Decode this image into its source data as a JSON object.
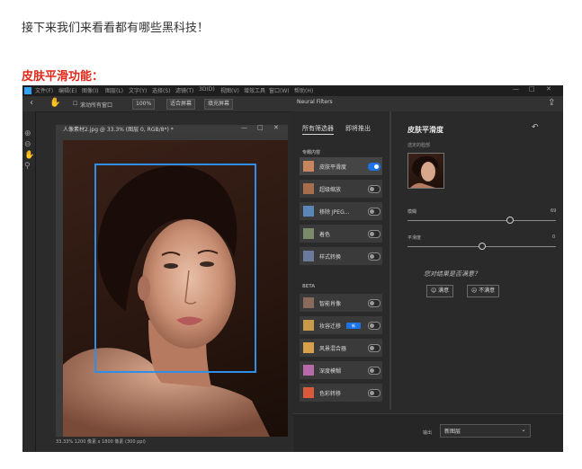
{
  "article": {
    "intro": "接下来我们来看看都有哪些黑科技！",
    "section_title": "皮肤平滑功能："
  },
  "app": {
    "menu": [
      "文件(F)",
      "编辑(E)",
      "图像(I)",
      "图层(L)",
      "文字(Y)",
      "选择(S)",
      "滤镜(T)",
      "3D(D)",
      "视图(V)",
      "增效工具",
      "窗口(W)",
      "帮助(H)"
    ],
    "window_controls": [
      "—",
      "□",
      "✕"
    ],
    "options_bar": {
      "checkbox_label": "滚动所有窗口",
      "zoom_value": "100%",
      "fit_screen": "适合屏幕",
      "fill_screen": "填充屏幕"
    },
    "neural_filters_tab": "Neural Filters",
    "document": {
      "title": "人像素材2.jpg @ 33.3% (图层 0, RGB/8*) *",
      "status": "33.33%   1200 像素 x 1800 像素 (300 ppi)"
    }
  },
  "filters_panel": {
    "tabs": [
      "所有筛选器",
      "即将推出"
    ],
    "groups": {
      "featured": "专题内容",
      "beta": "BETA"
    },
    "featured": [
      {
        "label": "皮肤平滑度",
        "on": true,
        "selected": true,
        "thumb_color": "#c8865e"
      },
      {
        "label": "超级缩放",
        "on": false,
        "selected": false,
        "thumb_color": "#a86e4c"
      },
      {
        "label": "移除 JPEG...",
        "on": false,
        "selected": false,
        "thumb_color": "#5a86b8"
      },
      {
        "label": "着色",
        "on": false,
        "selected": false,
        "thumb_color": "#7a8a6a"
      },
      {
        "label": "样式转换",
        "on": false,
        "selected": false,
        "thumb_color": "#6a7a9a"
      }
    ],
    "beta": [
      {
        "label": "智能肖像",
        "on": false,
        "badge": "",
        "thumb_color": "#8a6a5a"
      },
      {
        "label": "妆容迁移",
        "on": false,
        "badge": "新",
        "thumb_color": "#c89a4a"
      },
      {
        "label": "风景混合器",
        "on": false,
        "badge": "",
        "thumb_color": "#d8a04a"
      },
      {
        "label": "深度模糊",
        "on": false,
        "badge": "",
        "thumb_color": "#b86aa8"
      },
      {
        "label": "色彩转移",
        "on": false,
        "badge": "",
        "thumb_color": "#d85a3a"
      }
    ]
  },
  "detail": {
    "title": "皮肤平滑度",
    "ref_label": "选定的脸部",
    "sliders": [
      {
        "label": "模糊",
        "value": "69",
        "level": 0.69
      },
      {
        "label": "平滑度",
        "value": "0",
        "level": 0.5
      }
    ],
    "satisfied_question": "您对结果是否满意？",
    "satisfied_yes": "满意",
    "satisfied_no": "不满意",
    "output_label": "输出",
    "output_value": "新图层"
  }
}
